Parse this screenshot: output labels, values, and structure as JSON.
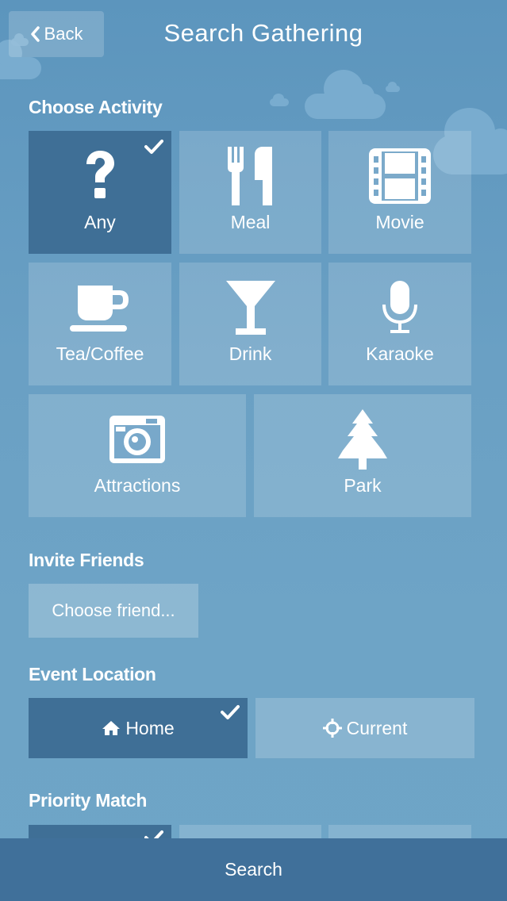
{
  "header": {
    "back_label": "Back",
    "title": "Search Gathering"
  },
  "sections": {
    "activity": "Choose Activity",
    "invite": "Invite Friends",
    "location": "Event Location",
    "priority": "Priority Match"
  },
  "activities": [
    {
      "label": "Any",
      "icon": "question-icon",
      "selected": true
    },
    {
      "label": "Meal",
      "icon": "fork-knife-icon",
      "selected": false
    },
    {
      "label": "Movie",
      "icon": "film-icon",
      "selected": false
    },
    {
      "label": "Tea/Coffee",
      "icon": "coffee-cup-icon",
      "selected": false
    },
    {
      "label": "Drink",
      "icon": "cocktail-icon",
      "selected": false
    },
    {
      "label": "Karaoke",
      "icon": "microphone-icon",
      "selected": false
    },
    {
      "label": "Attractions",
      "icon": "camera-icon",
      "selected": false
    },
    {
      "label": "Park",
      "icon": "tree-icon",
      "selected": false
    }
  ],
  "invite": {
    "button_label": "Choose friend..."
  },
  "location": {
    "home_label": "Home",
    "home_selected": true,
    "current_label": "Current",
    "current_selected": false
  },
  "search": {
    "label": "Search"
  },
  "colors": {
    "selected": "#3f6f96",
    "bar": "#40709a",
    "background": "#6aa0c4"
  }
}
